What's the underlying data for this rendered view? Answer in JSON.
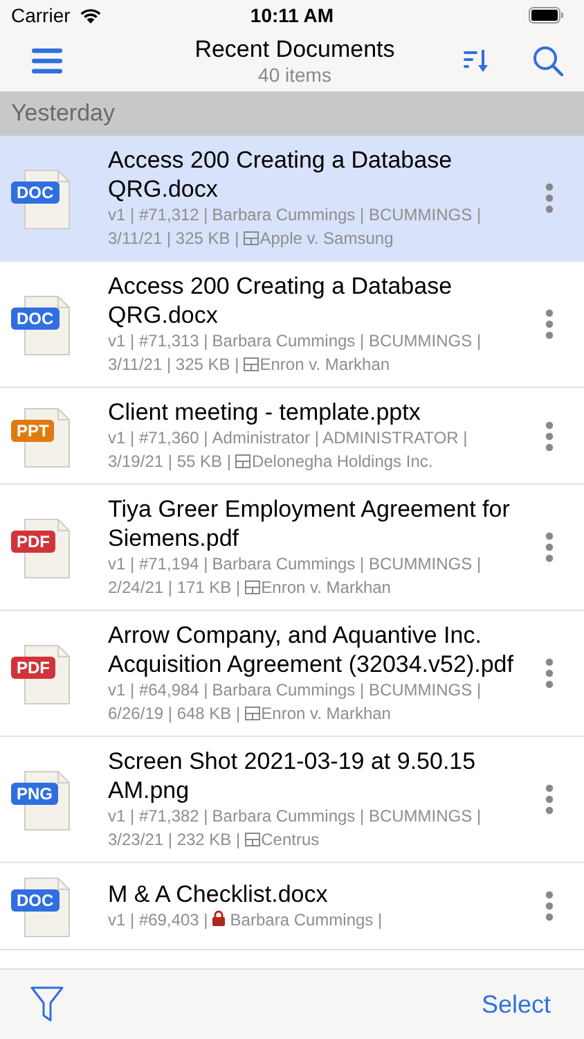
{
  "status_bar": {
    "carrier": "Carrier",
    "time": "10:11 AM"
  },
  "nav": {
    "title": "Recent Documents",
    "subtitle": "40 items"
  },
  "section": "Yesterday",
  "documents": [
    {
      "type": "DOC",
      "color": "#2f6fe0",
      "title": "Access 200 Creating a Database QRG.docx",
      "version_id": "v1 | #71,312 |",
      "locked": false,
      "owner": "Barbara Cummings | BCUMMINGS |",
      "details": "3/11/21 | 325 KB |",
      "matter": "Apple v. Samsung",
      "selected": true
    },
    {
      "type": "DOC",
      "color": "#2f6fe0",
      "title": "Access 200 Creating a Database QRG.docx",
      "version_id": "v1 | #71,313 |",
      "locked": false,
      "owner": "Barbara Cummings | BCUMMINGS |",
      "details": "3/11/21 | 325 KB |",
      "matter": "Enron v. Markhan",
      "selected": false
    },
    {
      "type": "PPT",
      "color": "#e07a10",
      "title": "Client meeting - template.pptx",
      "version_id": "v1 | #71,360 |",
      "locked": false,
      "owner": "Administrator | ADMINISTRATOR |",
      "details": "3/19/21 | 55 KB |",
      "matter": "Delonegha Holdings Inc.",
      "selected": false
    },
    {
      "type": "PDF",
      "color": "#d0343a",
      "title": "Tiya Greer Employment Agreement for Siemens.pdf",
      "version_id": "v1 | #71,194 |",
      "locked": false,
      "owner": "Barbara Cummings | BCUMMINGS |",
      "details": "2/24/21 | 171 KB |",
      "matter": "Enron v. Markhan",
      "selected": false
    },
    {
      "type": "PDF",
      "color": "#d0343a",
      "title": "Arrow Company, and Aquantive Inc. Acquisition Agreement (32034.v52).pdf",
      "version_id": "v1 | #64,984 |",
      "locked": false,
      "owner": "Barbara Cummings | BCUMMINGS |",
      "details": "6/26/19 | 648 KB |",
      "matter": "Enron v. Markhan",
      "selected": false
    },
    {
      "type": "PNG",
      "color": "#2f6fe0",
      "title": "Screen Shot 2021-03-19 at 9.50.15 AM.png",
      "version_id": "v1 | #71,382 |",
      "locked": false,
      "owner": "Barbara Cummings | BCUMMINGS |",
      "details": "3/23/21 | 232 KB |",
      "matter": "Centrus",
      "selected": false
    },
    {
      "type": "DOC",
      "color": "#2f6fe0",
      "title": "M & A Checklist.docx",
      "version_id": "v1 | #69,403 |",
      "locked": true,
      "owner": "Barbara Cummings |",
      "selected": false
    }
  ],
  "toolbar": {
    "select": "Select"
  }
}
